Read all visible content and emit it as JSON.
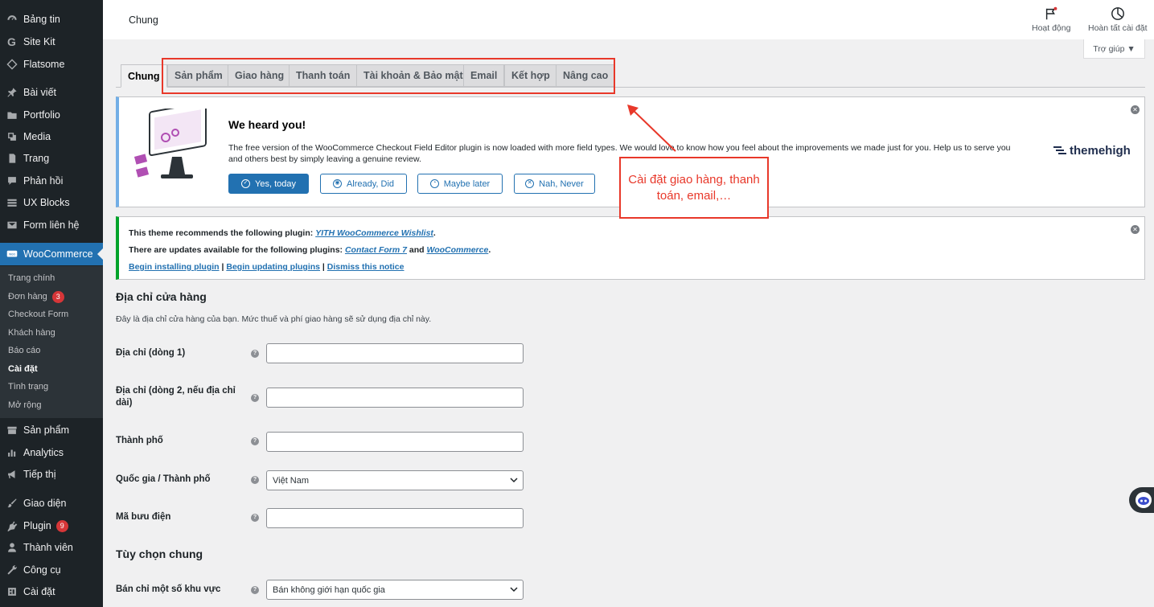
{
  "sidebar": {
    "items": [
      {
        "label": "Bảng tin",
        "icon": "dashboard-icon"
      },
      {
        "label": "Site Kit",
        "icon": "sitekit-icon"
      },
      {
        "label": "Flatsome",
        "icon": "flatsome-icon"
      },
      {
        "label": "Bài viết",
        "icon": "pin-icon"
      },
      {
        "label": "Portfolio",
        "icon": "portfolio-icon"
      },
      {
        "label": "Media",
        "icon": "media-icon"
      },
      {
        "label": "Trang",
        "icon": "page-icon"
      },
      {
        "label": "Phản hồi",
        "icon": "comment-icon"
      },
      {
        "label": "UX Blocks",
        "icon": "blocks-icon"
      },
      {
        "label": "Form liên hệ",
        "icon": "mail-icon"
      },
      {
        "label": "WooCommerce",
        "icon": "woo-icon"
      },
      {
        "label": "Sản phẩm",
        "icon": "archive-icon"
      },
      {
        "label": "Analytics",
        "icon": "chart-icon"
      },
      {
        "label": "Tiếp thị",
        "icon": "megaphone-icon"
      },
      {
        "label": "Giao diện",
        "icon": "brush-icon"
      },
      {
        "label": "Plugin",
        "icon": "plugin-icon",
        "count": "9"
      },
      {
        "label": "Thành viên",
        "icon": "user-icon"
      },
      {
        "label": "Công cụ",
        "icon": "wrench-icon"
      },
      {
        "label": "Cài đặt",
        "icon": "settings-icon"
      }
    ],
    "woo_sub": [
      {
        "label": "Trang chính"
      },
      {
        "label": "Đơn hàng",
        "count": "3"
      },
      {
        "label": "Checkout Form"
      },
      {
        "label": "Khách hàng"
      },
      {
        "label": "Báo cáo"
      },
      {
        "label": "Cài đặt"
      },
      {
        "label": "Tình trạng"
      },
      {
        "label": "Mở rộng"
      }
    ]
  },
  "header": {
    "title": "Chung",
    "activity_label": "Hoạt động",
    "finish_setup_label": "Hoàn tất cài đặt",
    "help_label": "Trợ giúp ▼"
  },
  "tabs": [
    "Chung",
    "Sản phẩm",
    "Giao hàng",
    "Thanh toán",
    "Tài khoản & Bảo mật",
    "Email",
    "Kết hợp",
    "Nâng cao"
  ],
  "review_notice": {
    "title": "We heard you!",
    "text": "The free version of the WooCommerce Checkout Field Editor plugin is now loaded with more field types. We would love to know how you feel about the improvements we made just for you. Help us to serve you and others best by simply leaving a genuine review.",
    "buttons": [
      "Yes, today",
      "Already, Did",
      "Maybe later",
      "Nah, Never"
    ],
    "brand": "themehigh"
  },
  "plugin_notice": {
    "line1_prefix": "This theme recommends the following plugin: ",
    "line1_link": "YITH WooCommerce Wishlist",
    "line1_suffix": ".",
    "line2_prefix": "There are updates available for the following plugins: ",
    "line2_link1": "Contact Form 7",
    "line2_mid": " and ",
    "line2_link2": "WooCommerce",
    "line2_suffix": ".",
    "action1": "Begin installing plugin",
    "action2": "Begin updating plugins",
    "action3": "Dismiss this notice",
    "sep": " | "
  },
  "annotation": {
    "text": "Cài đặt giao hàng, thanh toán, email,…",
    "color": "#e8382a"
  },
  "store_address": {
    "title": "Địa chỉ cửa hàng",
    "desc": "Đây là địa chỉ cửa hàng của bạn. Mức thuế và phí giao hàng sẽ sử dụng địa chỉ này.",
    "fields": {
      "address1": {
        "label": "Địa chỉ (dòng 1)",
        "value": ""
      },
      "address2": {
        "label": "Địa chỉ (dòng 2, nếu địa chỉ dài)",
        "value": ""
      },
      "city": {
        "label": "Thành phố",
        "value": ""
      },
      "country": {
        "label": "Quốc gia / Thành phố",
        "value": "Việt Nam"
      },
      "postcode": {
        "label": "Mã bưu điện",
        "value": ""
      }
    }
  },
  "general_options": {
    "title": "Tùy chọn chung",
    "sell_locations": {
      "label": "Bán chỉ một số khu vực",
      "value": "Bán không giới hạn quốc gia"
    }
  },
  "colors": {
    "accent": "#2271b1",
    "sidebar_bg": "#1d2327",
    "badge": "#d63638"
  }
}
